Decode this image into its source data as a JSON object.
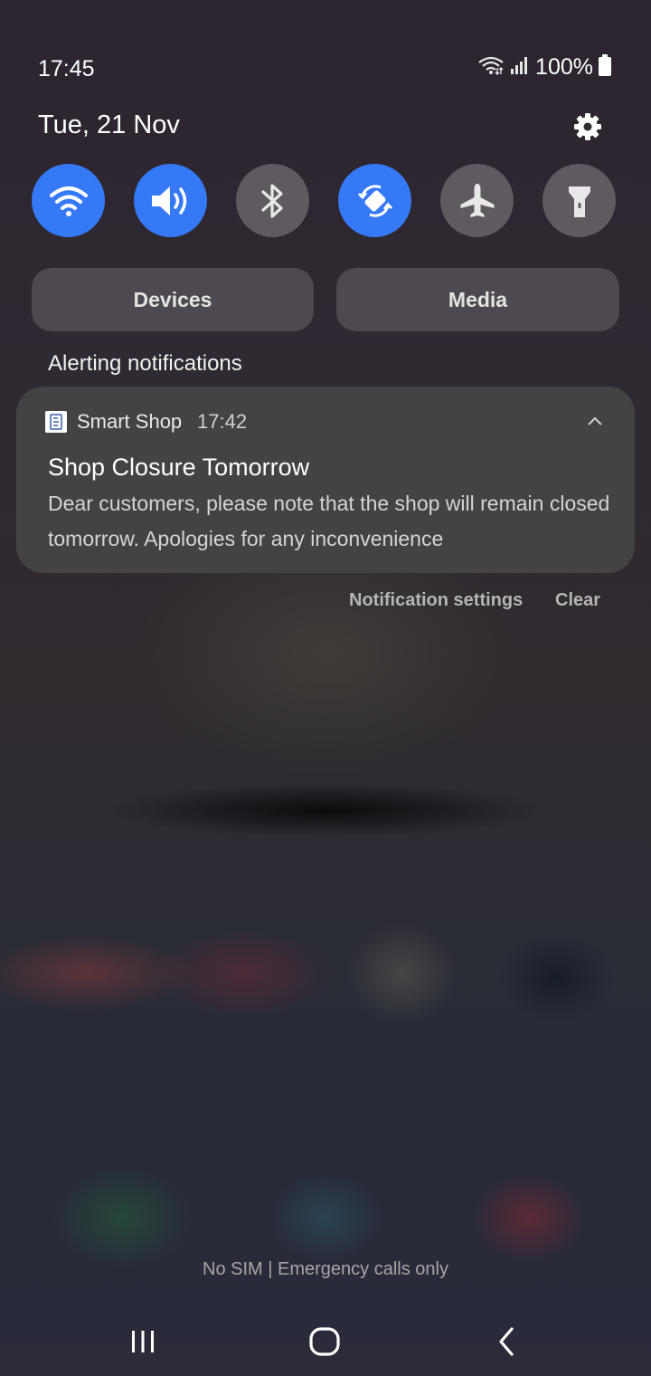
{
  "status_bar": {
    "time": "17:45",
    "battery_percent": "100%",
    "wifi_icon": "wifi-icon",
    "signal_icon": "cell-signal-icon",
    "battery_icon": "battery-full-icon"
  },
  "panel": {
    "date": "Tue, 21 Nov",
    "settings_icon": "gear-icon"
  },
  "quick_settings": [
    {
      "name": "wifi",
      "icon": "wifi-icon",
      "state": "on"
    },
    {
      "name": "sound",
      "icon": "volume-icon",
      "state": "on"
    },
    {
      "name": "bluetooth",
      "icon": "bluetooth-icon",
      "state": "off"
    },
    {
      "name": "auto-rotate",
      "icon": "rotate-icon",
      "state": "on"
    },
    {
      "name": "airplane-mode",
      "icon": "airplane-icon",
      "state": "off"
    },
    {
      "name": "flashlight",
      "icon": "flashlight-icon",
      "state": "off"
    }
  ],
  "buttons": {
    "devices": "Devices",
    "media": "Media"
  },
  "section_title": "Alerting notifications",
  "notification": {
    "app_name": "Smart Shop",
    "time": "17:42",
    "title": "Shop Closure Tomorrow",
    "body": "Dear customers, please note that the shop will remain closed tomorrow. Apologies for any inconvenience"
  },
  "actions": {
    "settings": "Notification settings",
    "clear": "Clear"
  },
  "sim_status": "No SIM | Emergency calls only",
  "colors": {
    "accent_on": "#3579f6",
    "tile_off": "#5f5a5f"
  }
}
